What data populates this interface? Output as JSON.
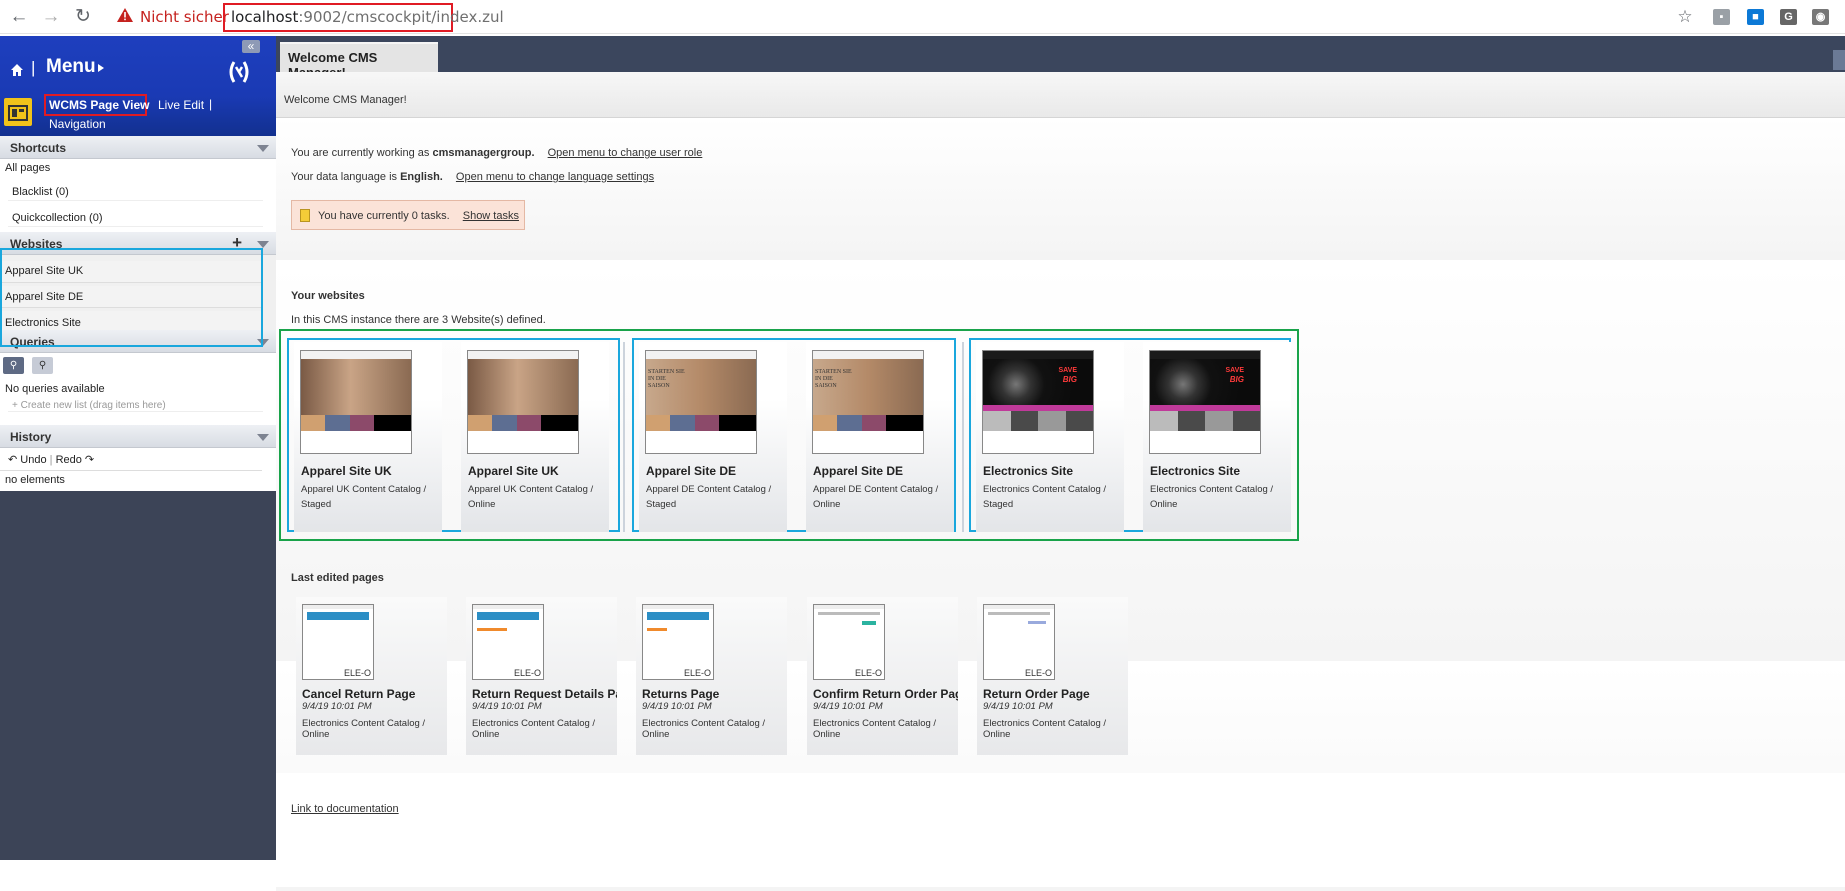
{
  "browser": {
    "insecure_label": "Nicht sicher",
    "url_host": "localhost",
    "url_path": ":9002/cmscockpit/index.zul"
  },
  "sidebar": {
    "menu_title": "Menu",
    "perspective": {
      "active": "WCMS Page View",
      "live_edit": "Live Edit",
      "navigation": "Navigation"
    },
    "shortcuts": {
      "title": "Shortcuts",
      "all_pages": "All pages",
      "items": [
        "Blacklist (0)",
        "Quickcollection (0)"
      ]
    },
    "websites": {
      "title": "Websites",
      "items": [
        "Apparel Site UK",
        "Apparel Site DE",
        "Electronics Site"
      ]
    },
    "queries": {
      "title": "Queries",
      "empty": "No queries available",
      "create_hint": "+ Create new list (drag items here)"
    },
    "history": {
      "title": "History",
      "undo": "Undo",
      "redo": "Redo",
      "empty": "no elements"
    }
  },
  "main": {
    "tab": "Welcome CMS Manager!",
    "welcome": "Welcome CMS Manager!",
    "user_role_prefix": "You are currently working as",
    "user_role": "cmsmanagergroup.",
    "user_role_link": "Open menu to change user role",
    "lang_prefix": "Your data language is",
    "lang": "English.",
    "lang_link": "Open menu to change language settings",
    "tasks_text": "You have currently 0 tasks.",
    "tasks_link": "Show tasks",
    "websites_title": "Your websites",
    "websites_info": "In this CMS instance there are 3 Website(s) defined.",
    "sites": [
      {
        "name": "Apparel Site UK",
        "catalog": "Apparel UK Content Catalog /",
        "version": "Staged"
      },
      {
        "name": "Apparel Site UK",
        "catalog": "Apparel UK Content Catalog /",
        "version": "Online"
      },
      {
        "name": "Apparel Site DE",
        "catalog": "Apparel DE Content Catalog /",
        "version": "Staged"
      },
      {
        "name": "Apparel Site DE",
        "catalog": "Apparel DE Content Catalog /",
        "version": "Online"
      },
      {
        "name": "Electronics Site",
        "catalog": "Electronics Content Catalog /",
        "version": "Staged"
      },
      {
        "name": "Electronics Site",
        "catalog": "Electronics Content Catalog /",
        "version": "Online"
      }
    ],
    "last_edited_title": "Last edited pages",
    "pages": [
      {
        "name": "Cancel Return Page",
        "date": "9/4/19 10:01 PM",
        "catalog": "Electronics Content Catalog / Online",
        "badge": "ELE-O"
      },
      {
        "name": "Return Request Details Pag",
        "date": "9/4/19 10:01 PM",
        "catalog": "Electronics Content Catalog / Online",
        "badge": "ELE-O"
      },
      {
        "name": "Returns Page",
        "date": "9/4/19 10:01 PM",
        "catalog": "Electronics Content Catalog / Online",
        "badge": "ELE-O"
      },
      {
        "name": "Confirm Return Order Page",
        "date": "9/4/19 10:01 PM",
        "catalog": "Electronics Content Catalog / Online",
        "badge": "ELE-O"
      },
      {
        "name": "Return Order Page",
        "date": "9/4/19 10:01 PM",
        "catalog": "Electronics Content Catalog / Online",
        "badge": "ELE-O"
      }
    ],
    "doc_link": "Link to documentation",
    "thumb_texts": {
      "de": "STARTEN SIE IN DIE SAISON",
      "save": "SAVE",
      "big": "BIG"
    }
  }
}
